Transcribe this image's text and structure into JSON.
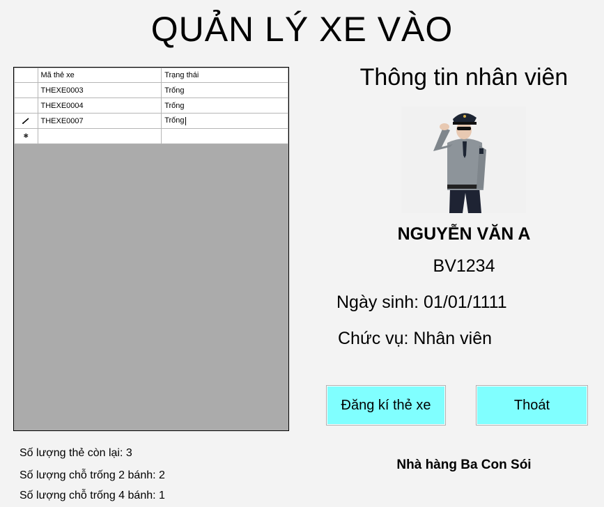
{
  "window": {
    "title": "QUẢN LÝ XE VÀO"
  },
  "grid": {
    "columns": [
      "Mã thẻ xe",
      "Trạng thái"
    ],
    "rows": [
      {
        "ma_the": "THEXE0003",
        "trang_thai": "Trống"
      },
      {
        "ma_the": "THEXE0004",
        "trang_thai": "Trống"
      },
      {
        "ma_the": "THEXE0007",
        "trang_thai": "Trống"
      }
    ],
    "row_header_icons": [
      "",
      "",
      "edit-pencil-icon",
      "new-row-asterisk-icon"
    ]
  },
  "employee": {
    "section_title": "Thông tin nhân viên",
    "name": "NGUYỄN VĂN A",
    "id": "BV1234",
    "dob_text": "Ngày sinh: 01/01/1111",
    "role_text": "Chức vụ: Nhân viên",
    "photo_icon": "security-guard-photo"
  },
  "buttons": {
    "register": "Đăng kí thẻ xe",
    "exit": "Thoát"
  },
  "stats": {
    "cards_left": "Số lượng thẻ còn lại: 3",
    "slots_2wheel": "Số lượng chỗ trống 2 bánh: 2",
    "slots_4wheel": "Số lượng chỗ trống 4 bánh: 1"
  },
  "footer": {
    "company": "Nhà hàng Ba Con Sói"
  },
  "colors": {
    "button_bg": "#80ffff",
    "grid_empty_bg": "#ababab",
    "window_bg": "#f3f3f3"
  }
}
